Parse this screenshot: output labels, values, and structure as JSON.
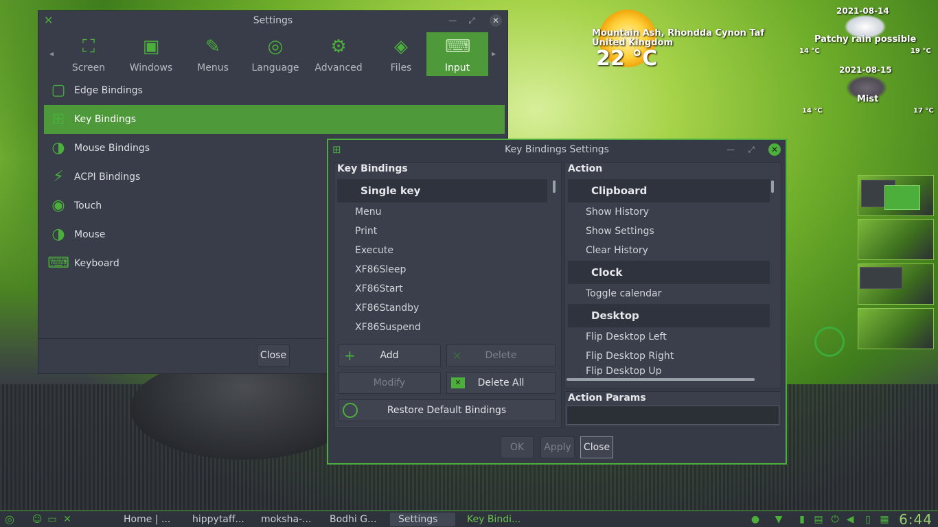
{
  "weather": {
    "location_line1": "Mountain Ash, Rhondda Cynon Taf",
    "location_line2": "United Kingdom",
    "temperature": "22 °C",
    "day1": {
      "date": "2021-08-14",
      "condition": "Patchy rain possible",
      "low": "14 °C",
      "high": "19 °C"
    },
    "day2": {
      "date": "2021-08-15",
      "condition": "Mist",
      "low": "14 °C",
      "high": "17 °C"
    }
  },
  "settings_window": {
    "title": "Settings",
    "tabs": [
      {
        "label": "Screen",
        "icon": "screen-icon"
      },
      {
        "label": "Windows",
        "icon": "window-icon"
      },
      {
        "label": "Menus",
        "icon": "menu-edit-icon"
      },
      {
        "label": "Language",
        "icon": "globe-icon"
      },
      {
        "label": "Advanced",
        "icon": "gears-icon"
      },
      {
        "label": "Files",
        "icon": "files-bag-icon"
      },
      {
        "label": "Input",
        "icon": "keyboard-mouse-icon",
        "active": true
      }
    ],
    "items": [
      {
        "label": "Edge Bindings"
      },
      {
        "label": "Key Bindings",
        "selected": true
      },
      {
        "label": "Mouse Bindings"
      },
      {
        "label": "ACPI Bindings"
      },
      {
        "label": "Touch"
      },
      {
        "label": "Mouse"
      },
      {
        "label": "Keyboard"
      }
    ],
    "close_label": "Close"
  },
  "kb_dialog": {
    "title": "Key Bindings Settings",
    "bindings_header": "Key Bindings",
    "bindings_group": "Single key",
    "bindings": [
      "Menu",
      "Print",
      "Execute",
      "XF86Sleep",
      "XF86Start",
      "XF86Standby",
      "XF86Suspend"
    ],
    "action_header": "Action",
    "action_groups": [
      {
        "name": "Clipboard",
        "items": [
          "Show History",
          "Show Settings",
          "Clear History"
        ]
      },
      {
        "name": "Clock",
        "items": [
          "Toggle calendar"
        ]
      },
      {
        "name": "Desktop",
        "items": [
          "Flip Desktop Left",
          "Flip Desktop Right",
          "Flip Desktop Up"
        ]
      }
    ],
    "add_label": "Add",
    "delete_label": "Delete",
    "modify_label": "Modify",
    "delete_all_label": "Delete All",
    "restore_label": "Restore Default Bindings",
    "action_params_header": "Action Params",
    "action_params_value": "",
    "ok_label": "OK",
    "apply_label": "Apply",
    "close_label": "Close"
  },
  "taskbar": {
    "tasks": [
      "Home | ...",
      "hippytaff...",
      "moksha-...",
      "Bodhi G...",
      "Settings",
      "Key Bindi..."
    ],
    "clock": "6:44"
  },
  "colors": {
    "accent": "#4caf3c",
    "selection": "#4e9a3a",
    "window_bg": "#383d49"
  }
}
